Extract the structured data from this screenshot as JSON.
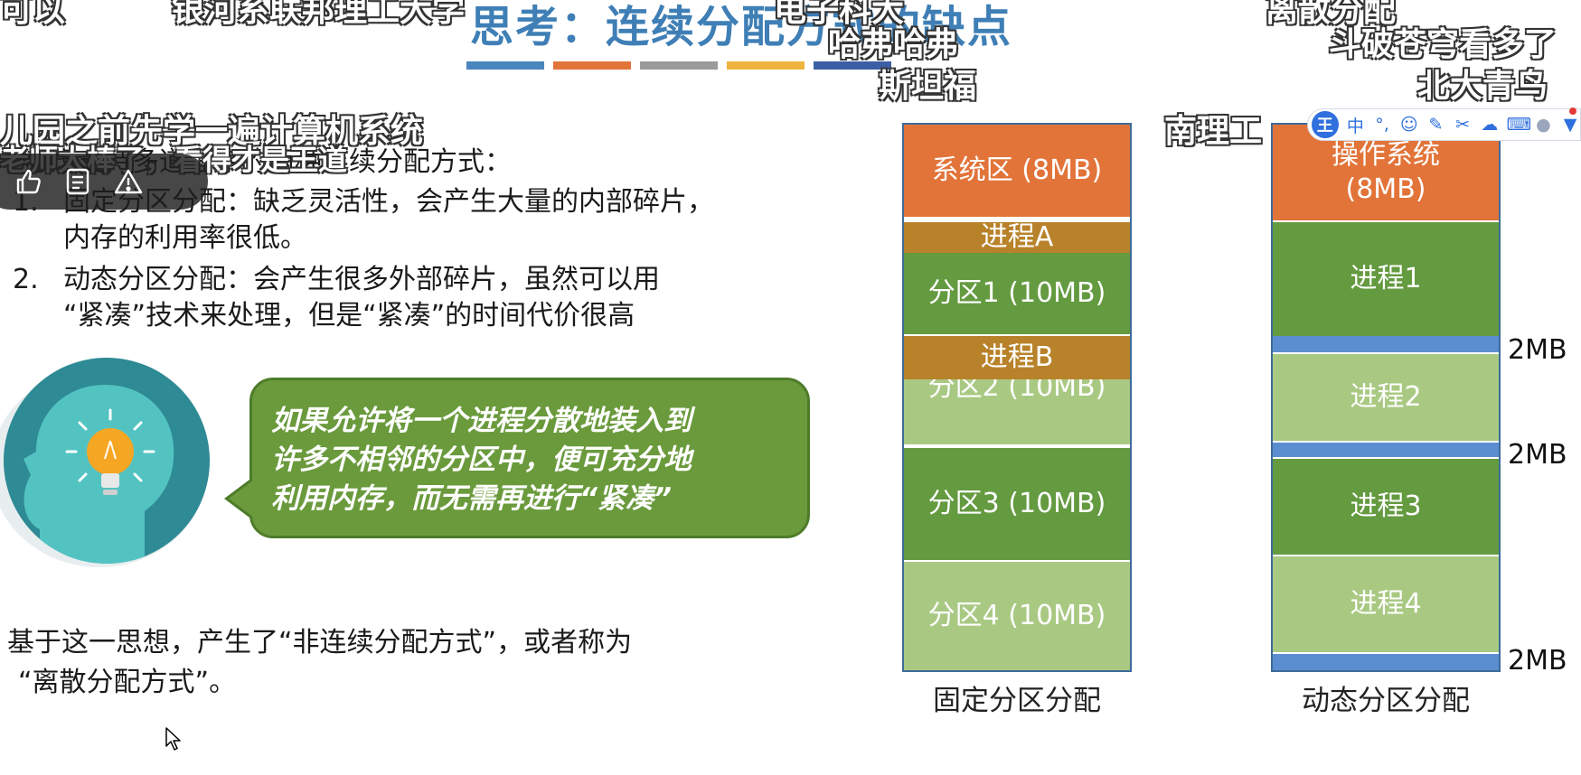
{
  "slide": {
    "title": "思考：连续分配方式的缺点",
    "title_bar_colors": [
      "#4a86be",
      "#e27439",
      "#9a9a9a",
      "#efb33f",
      "#3c5fa4"
    ],
    "intro": "考虑支持多道程序的两种连续分配方式：",
    "list": [
      {
        "num": "1.",
        "lines": [
          "固定分区分配：缺乏灵活性，会产生大量的内部碎片，",
          "内存的利用率很低。"
        ]
      },
      {
        "num": "2.",
        "lines": [
          "动态分区分配：会产生很多外部碎片，虽然可以用",
          "“紧凑”技术来处理，但是“紧凑”的时间代价很高"
        ]
      }
    ],
    "bubble_lines": [
      "如果允许将一个进程分散地装入到",
      "许多不相邻的分区中，便可充分地",
      "利用内存，而无需再进行“紧凑”"
    ],
    "conclusion_lines": [
      "基于这一思想，产生了“非连续分配方式”，或者称为",
      "“离散分配方式”。"
    ]
  },
  "fixed_partition": {
    "caption": "固定分区分配",
    "system": "系统区 (8MB)",
    "process_a": "进程A",
    "partition1": "分区1 (10MB)",
    "process_b": "进程B",
    "partition2": "分区2 (10MB)",
    "partition3": "分区3 (10MB)",
    "partition4": "分区4 (10MB)"
  },
  "dynamic_partition": {
    "caption": "动态分区分配",
    "os_line1": "操作系统",
    "os_line2": "(8MB)",
    "process1": "进程1",
    "process2": "进程2",
    "process3": "进程3",
    "process4": "进程4",
    "gap_label": "2MB"
  },
  "colors": {
    "title": "#3f7fb6",
    "orange": "#e27439",
    "dark_green": "#649a40",
    "light_green": "#a9c983",
    "process_brown": "#b8822a",
    "gap_blue": "#5b8ed0",
    "bubble_green": "#6a9a3c",
    "head_teal": "#2e8a94"
  },
  "danmaku": [
    "可以",
    "银河系联邦理工大学",
    "电子科大",
    "哈弗哈弗",
    "斯坦福",
    "儿园之前先学一遍计算机系统",
    "老师太棒了，看得才是王道",
    "南理工",
    "离散分配",
    "斗破苍穹看多了",
    "北大青鸟"
  ],
  "video_actions": {
    "like_icon": "thumbs-up-icon",
    "notes_icon": "notes-icon",
    "report_icon": "warning-icon"
  },
  "ime_toolbar": {
    "logo": "王",
    "mode": "中",
    "punct": "°,"
  }
}
